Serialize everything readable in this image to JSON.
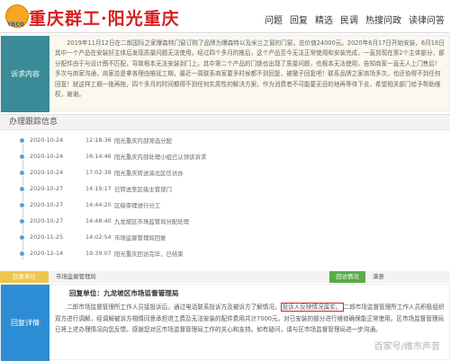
{
  "header": {
    "logo_text": "YBCQ",
    "brand": "重庆群工·阳光重庆",
    "nav": [
      "问题",
      "回复",
      "精选",
      "民调",
      "热搜问政",
      "读律问答"
    ]
  },
  "request": {
    "label": "诉求内容",
    "text": "2019年11月12日在二郎国际之家爆森特门窗订购了品牌为爆森特以及米兰之窗的门窗，总价值24000元。2020年6月17日开始安装，6月18日其中一个产品在安装好主体后发现质量问题无法使用，经过四个多月的推后，这个产品至今无法正常使用和安装完成，一直到现在第2个主体部分，部分配件由于与设计图不匹配，导致根本无法安装到门上。其中第二个产品的门锁也出现了质量问题，也根本无法使用，告知商家一直无人上门售后！多次与商家沟通，商家总是拿各理由推延工期，最近一周联系商家要多时候都不到回复，被撤子回复吧！联系品牌之家商场多次，也还协得不到任何回复！就这样工期一拖再拖，四个多月的时间都得不到任何实质性的解决方案，作为消费者不可能要无目的地再等待下去，希望相关部门给予帮助维权，谢谢。"
  },
  "tracking": {
    "title": "办理跟踪信息",
    "items": [
      {
        "date": "2020-10-24",
        "time": "12:18:36",
        "text": "阳光重庆内部筛选分配"
      },
      {
        "date": "2020-10-24",
        "time": "16:14:46",
        "text": "阳光重庆内部处理小组已认领该诉求"
      },
      {
        "date": "2020-10-24",
        "time": "17:02:39",
        "text": "阳光重庆转送渝北区信访办"
      },
      {
        "date": "2020-10-27",
        "time": "14:19:17",
        "text": "已转送至区级主管部门"
      },
      {
        "date": "2020-10-27",
        "time": "14:44:20",
        "text": "区级审理进行分工"
      },
      {
        "date": "2020-10-27",
        "time": "14:48:40",
        "text": "九龙坡区市场监管局分配处理"
      },
      {
        "date": "2020-11-25",
        "time": "14:02:54",
        "text": "市场监督管理局回复"
      },
      {
        "date": "2020-12-14",
        "time": "19:39:07",
        "text": "阳光重庆回访完毕，已结束"
      }
    ]
  },
  "reply_bar": {
    "unit_label": "回复单位",
    "unit_value": "市场监督管理局",
    "status_label": "回访情况",
    "status_value": "满意"
  },
  "reply": {
    "label": "回复详情",
    "unit_line": "回复单位：九龙坡区市场监督管理局",
    "text_before": "二郎市场监督管理所工作人员接投诉后，通过电话联系投诉方及被诉方了解情况，",
    "text_highlight": "投诉人反映情况属实。",
    "text_after": "二郎市场监督管理所工作人员积极组织双方进行调解，经调解被诉方相情同意承担退工费及无法安装的配件费用共计7000元，对已安装的部分进行维修确保能正常使用。区市场监督管理局已将上述办理情况向您反馈。感谢您对区市场监督管理局工作的关心和支持。如有疑问，请与区市场监督管理局进一步沟通。"
  },
  "watermark": "百家号/维市声音"
}
